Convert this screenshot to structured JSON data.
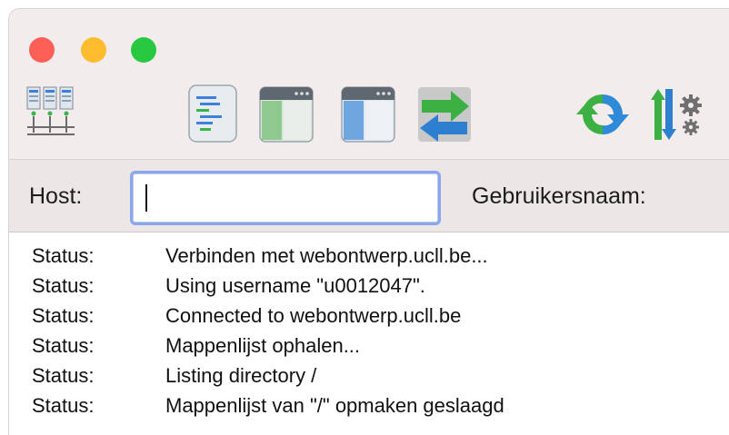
{
  "window": {
    "traffic_lights": [
      {
        "name": "close",
        "color": "#fe5f57"
      },
      {
        "name": "minimize",
        "color": "#febc2e"
      },
      {
        "name": "zoom",
        "color": "#28c840"
      }
    ]
  },
  "toolbar": {
    "icons": [
      "site-manager-icon",
      "message-log-icon",
      "local-tree-icon",
      "remote-tree-icon",
      "transfer-queue-icon",
      "refresh-icon",
      "filter-settings-icon"
    ]
  },
  "quickconnect": {
    "host_label": "Host:",
    "host_value": "",
    "username_label": "Gebruikersnaam:"
  },
  "log": [
    {
      "label": "Status:",
      "message": "Verbinden met webontwerp.ucll.be..."
    },
    {
      "label": "Status:",
      "message": "Using username \"u0012047\"."
    },
    {
      "label": "Status:",
      "message": "Connected to webontwerp.ucll.be"
    },
    {
      "label": "Status:",
      "message": "Mappenlijst ophalen..."
    },
    {
      "label": "Status:",
      "message": "Listing directory /"
    },
    {
      "label": "Status:",
      "message": "Mappenlijst van \"/\" opmaken geslaagd"
    }
  ]
}
